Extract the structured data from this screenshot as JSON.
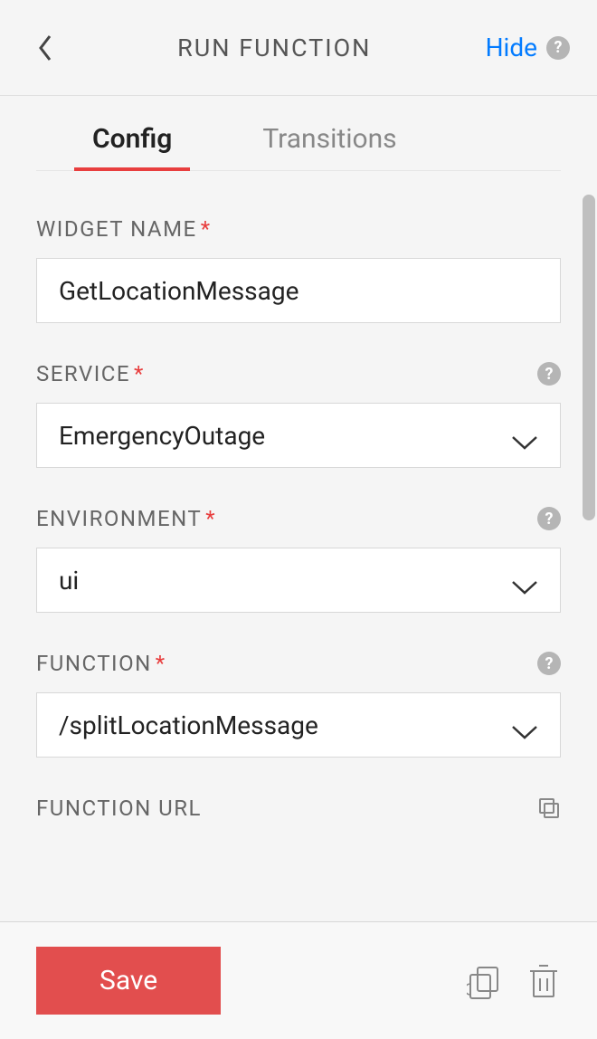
{
  "header": {
    "title": "RUN FUNCTION",
    "hide": "Hide"
  },
  "tabs": [
    {
      "label": "Config",
      "active": true
    },
    {
      "label": "Transitions",
      "active": false
    }
  ],
  "fields": {
    "widget_name": {
      "label": "WIDGET NAME",
      "value": "GetLocationMessage",
      "required": true
    },
    "service": {
      "label": "SERVICE",
      "value": "EmergencyOutage",
      "required": true,
      "help": true
    },
    "environment": {
      "label": "ENVIRONMENT",
      "value": "ui",
      "required": true,
      "help": true
    },
    "function": {
      "label": "FUNCTION",
      "value": "/splitLocationMessage",
      "required": true,
      "help": true
    },
    "function_url": {
      "label": "FUNCTION URL",
      "required": false
    }
  },
  "footer": {
    "save": "Save"
  }
}
